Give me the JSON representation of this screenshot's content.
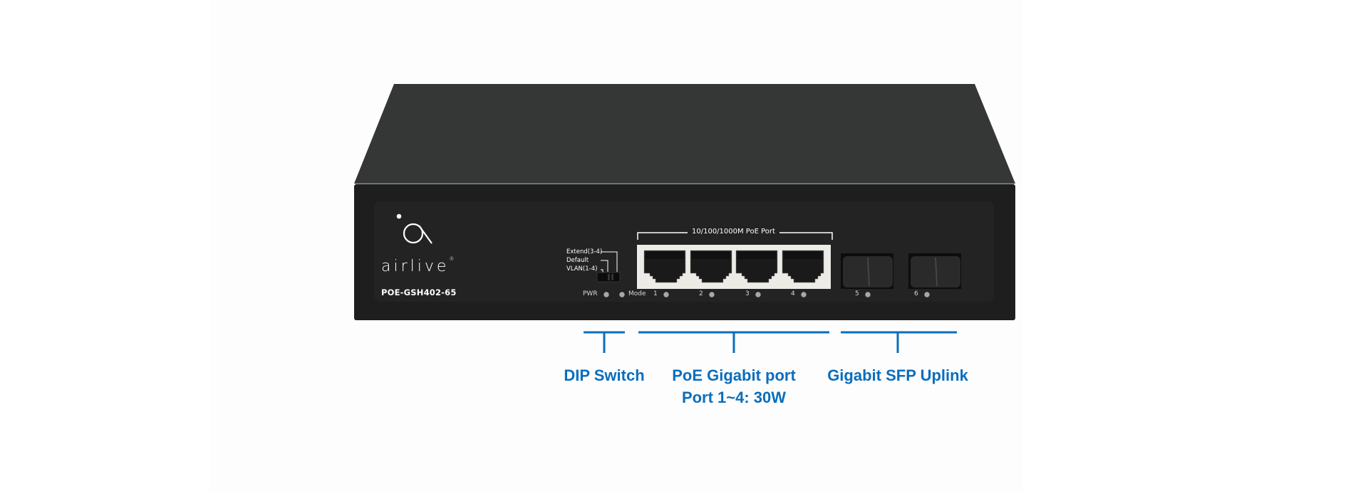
{
  "product": {
    "brand": "airlive",
    "brand_mark": "®",
    "model": "POE-GSH402-65"
  },
  "front_panel": {
    "port_group_header": "10/100/1000M PoE Port",
    "dip_switch": {
      "options": [
        "Extend(3-4)",
        "Default",
        "VLAN(1-4)"
      ]
    },
    "leds": [
      {
        "label": "PWR"
      },
      {
        "label": "Mode"
      },
      {
        "label": "1"
      },
      {
        "label": "2"
      },
      {
        "label": "3"
      },
      {
        "label": "4"
      },
      {
        "label": "5"
      },
      {
        "label": "6"
      }
    ],
    "rj45_ports": [
      "1",
      "2",
      "3",
      "4"
    ],
    "sfp_ports": [
      "5",
      "6"
    ]
  },
  "callouts": [
    {
      "id": "dip",
      "lines": [
        "DIP Switch"
      ]
    },
    {
      "id": "poe",
      "lines": [
        "PoE Gigabit port",
        "Port 1~4: 30W"
      ]
    },
    {
      "id": "sfp",
      "lines": [
        "Gigabit SFP Uplink"
      ]
    }
  ],
  "colors": {
    "callout_blue": "#0a6ebd",
    "chassis_top": "#353636",
    "chassis_front": "#1e1e1e",
    "panel": "#232323"
  }
}
